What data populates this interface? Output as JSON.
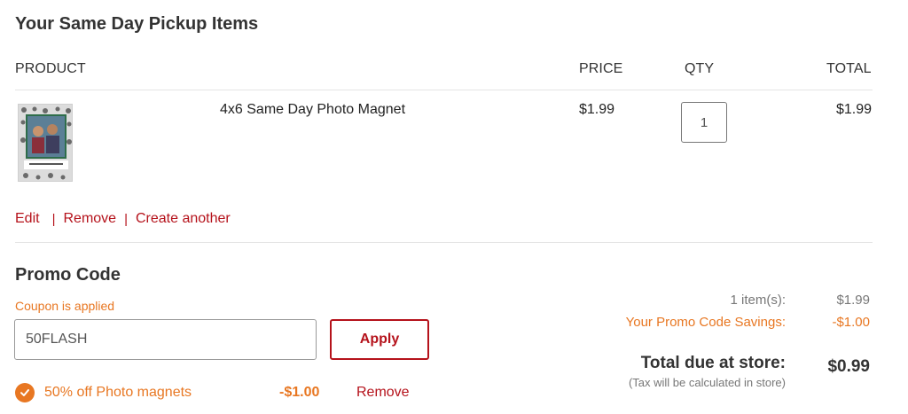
{
  "page": {
    "title": "Your Same Day Pickup Items"
  },
  "table": {
    "headers": {
      "product": "PRODUCT",
      "price": "PRICE",
      "qty": "QTY",
      "total": "TOTAL"
    },
    "rows": [
      {
        "name": "4x6 Same Day Photo Magnet",
        "price": "$1.99",
        "qty": "1",
        "total": "$1.99",
        "actions": {
          "edit": "Edit",
          "remove": "Remove",
          "create_another": "Create another",
          "separator": "|"
        }
      }
    ]
  },
  "promo": {
    "title": "Promo Code",
    "status": "Coupon is applied",
    "code_value": "50FLASH",
    "apply_label": "Apply",
    "applied_coupon": {
      "description": "50% off Photo magnets",
      "amount": "-$1.00",
      "remove_label": "Remove"
    }
  },
  "summary": {
    "items_label": "1 item(s):",
    "items_value": "$1.99",
    "savings_label": "Your Promo Code Savings:",
    "savings_value": "-$1.00",
    "total_label": "Total due at store:",
    "total_value": "$0.99",
    "tax_note": "(Tax will be calculated in store)"
  },
  "colors": {
    "accent_red": "#b5121b",
    "accent_orange": "#e87722"
  },
  "icons": {
    "coupon_check": "check-circle-icon"
  }
}
